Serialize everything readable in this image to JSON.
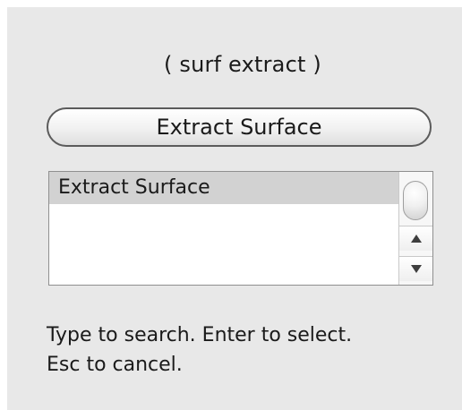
{
  "header": {
    "command_name": "( surf extract )"
  },
  "search": {
    "value": "Extract Surface"
  },
  "results": {
    "items": [
      {
        "label": "Extract Surface",
        "selected": true
      }
    ]
  },
  "scrollbar": {
    "up_icon": "arrow-up-icon",
    "down_icon": "arrow-down-icon"
  },
  "hint": {
    "line1": "Type to search. Enter to select.",
    "line2": "Esc to cancel."
  },
  "colors": {
    "background": "#e8e8e8",
    "selection": "#d2d2d2",
    "text": "#1a1a1a"
  }
}
